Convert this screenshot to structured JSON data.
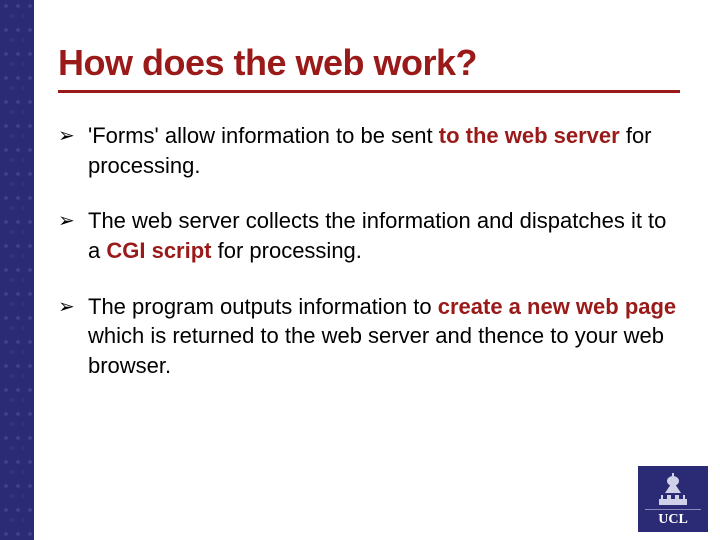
{
  "title": "How does the web work?",
  "bullets": [
    {
      "segments": [
        {
          "text": "'Forms' allow information to be sent ",
          "emph": false
        },
        {
          "text": "to the web server",
          "emph": true
        },
        {
          "text": " for processing.",
          "emph": false
        }
      ]
    },
    {
      "segments": [
        {
          "text": "The web server collects the information and dispatches it to a ",
          "emph": false
        },
        {
          "text": "CGI script",
          "emph": true
        },
        {
          "text": " for processing.",
          "emph": false
        }
      ]
    },
    {
      "segments": [
        {
          "text": "The program outputs information to ",
          "emph": false
        },
        {
          "text": "create a new web page",
          "emph": true
        },
        {
          "text": " which is returned to the web server and thence to your web browser.",
          "emph": false
        }
      ]
    }
  ],
  "bullet_marker": "➢",
  "logo": {
    "text": "UCL"
  }
}
